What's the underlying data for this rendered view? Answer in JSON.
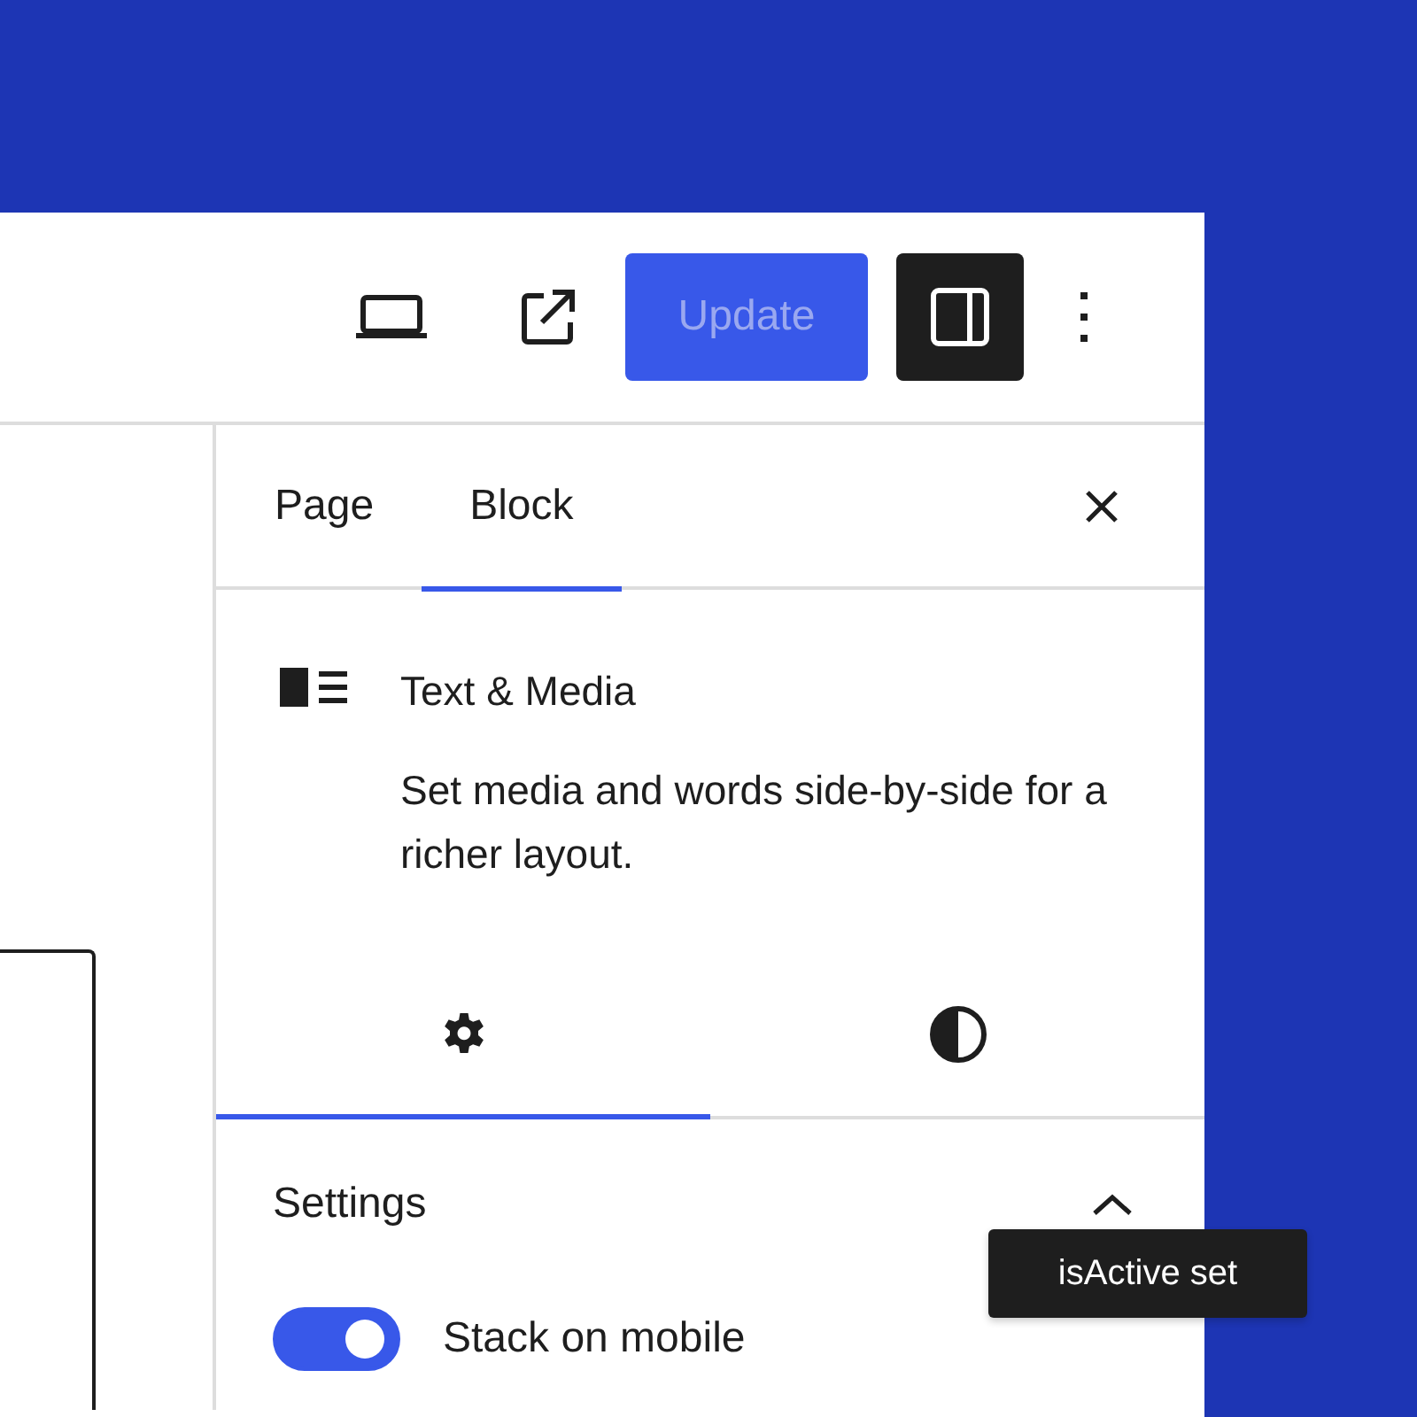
{
  "toolbar": {
    "update_button": {
      "label": "Update",
      "disabled": true
    },
    "sidebar_toggle": {
      "pressed": true
    }
  },
  "sidebar": {
    "tabs": [
      {
        "label": "Page",
        "selected": false
      },
      {
        "label": "Block",
        "selected": true
      }
    ],
    "block": {
      "title": "Text & Media",
      "description": "Set media and words side-by-side for a richer layout."
    },
    "inspector_tabs": [
      {
        "kind": "settings",
        "selected": true
      },
      {
        "kind": "styles",
        "selected": false
      }
    ],
    "panel": {
      "title": "Settings",
      "expanded": true,
      "toggles": [
        {
          "label": "Stack on mobile",
          "on": true
        }
      ]
    }
  },
  "tooltip": {
    "text": "isActive set"
  }
}
